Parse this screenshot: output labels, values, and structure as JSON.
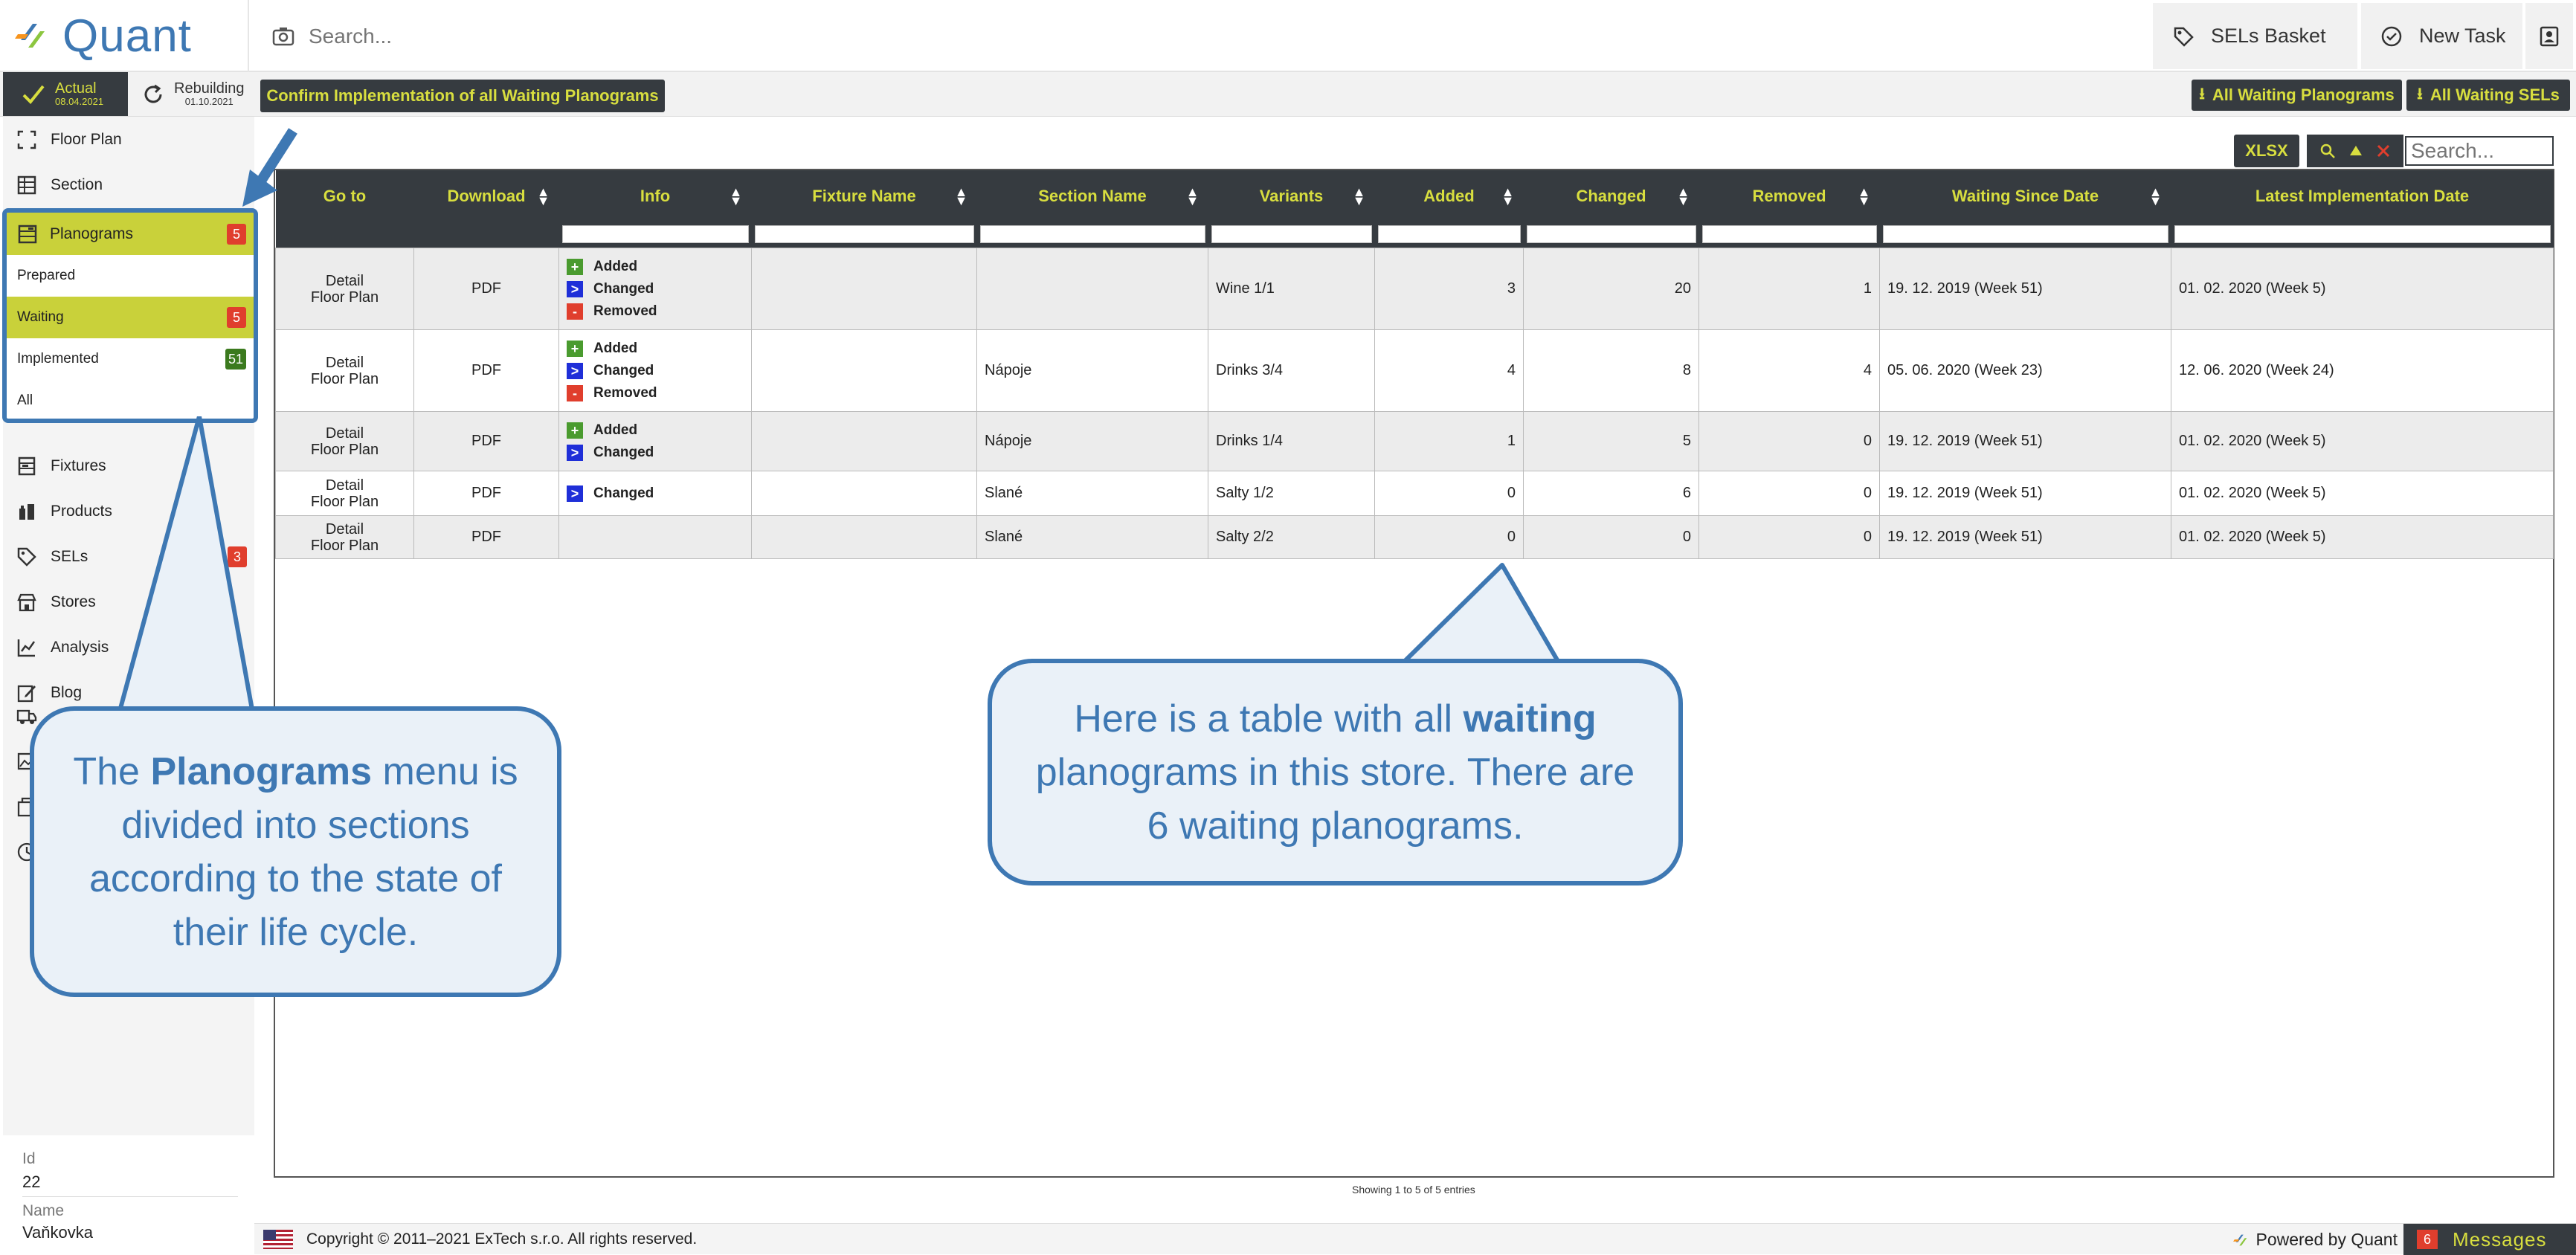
{
  "app": {
    "name": "Quant"
  },
  "topbar": {
    "search_placeholder": "Search...",
    "sels_basket": "SELs Basket",
    "new_task": "New Task"
  },
  "toolbar": {
    "actual_label": "Actual",
    "actual_date": "08.04.2021",
    "rebuilding_label": "Rebuilding",
    "rebuilding_date": "01.10.2021",
    "confirm_button": "Confirm Implementation of all Waiting Planograms",
    "all_waiting_planograms": "All Waiting Planograms",
    "all_waiting_sels": "All Waiting SELs"
  },
  "sidebar": {
    "items": [
      {
        "label": "Floor Plan",
        "icon": "floor-plan-icon"
      },
      {
        "label": "Section",
        "icon": "section-icon"
      },
      {
        "label": "Planograms",
        "icon": "planograms-icon",
        "badge": "5"
      },
      {
        "label": "Fixtures",
        "icon": "fixtures-icon"
      },
      {
        "label": "Products",
        "icon": "products-icon"
      },
      {
        "label": "SELs",
        "icon": "sels-icon",
        "badge": "3"
      },
      {
        "label": "Stores",
        "icon": "stores-icon"
      },
      {
        "label": "Analysis",
        "icon": "analysis-icon"
      },
      {
        "label": "Blog",
        "icon": "blog-icon"
      }
    ],
    "planogram_states": [
      {
        "label": "Prepared"
      },
      {
        "label": "Waiting",
        "badge": "5"
      },
      {
        "label": "Implemented",
        "badge": "51"
      },
      {
        "label": "All"
      }
    ],
    "store_info": {
      "id_label": "Id",
      "id_value": "22",
      "name_label": "Name",
      "name_value": "Vaňkovka"
    }
  },
  "table_tools": {
    "xlsx": "XLSX",
    "search_placeholder": "Search..."
  },
  "table": {
    "columns": [
      "Go to",
      "Download",
      "Info",
      "Fixture Name",
      "Section Name",
      "Variants",
      "Added",
      "Changed",
      "Removed",
      "Waiting Since Date",
      "Latest Implementation Date"
    ],
    "info_labels": {
      "added": "Added",
      "changed": "Changed",
      "removed": "Removed"
    },
    "rows": [
      {
        "goto1": "Detail",
        "goto2": "Floor Plan",
        "download": "PDF",
        "info": [
          "added",
          "changed",
          "removed"
        ],
        "fixture": "",
        "section": "",
        "variants": "Wine 1/1",
        "added": "3",
        "changed": "20",
        "removed": "1",
        "waiting_since": "19. 12. 2019 (Week 51)",
        "latest_impl": "01. 02. 2020 (Week 5)"
      },
      {
        "goto1": "Detail",
        "goto2": "Floor Plan",
        "download": "PDF",
        "info": [
          "added",
          "changed",
          "removed"
        ],
        "fixture": "",
        "section": "Nápoje",
        "variants": "Drinks 3/4",
        "added": "4",
        "changed": "8",
        "removed": "4",
        "waiting_since": "05. 06. 2020 (Week 23)",
        "latest_impl": "12. 06. 2020 (Week 24)"
      },
      {
        "goto1": "Detail",
        "goto2": "Floor Plan",
        "download": "PDF",
        "info": [
          "added",
          "changed"
        ],
        "fixture": "",
        "section": "Nápoje",
        "variants": "Drinks 1/4",
        "added": "1",
        "changed": "5",
        "removed": "0",
        "waiting_since": "19. 12. 2019 (Week 51)",
        "latest_impl": "01. 02. 2020 (Week 5)"
      },
      {
        "goto1": "Detail",
        "goto2": "Floor Plan",
        "download": "PDF",
        "info": [
          "changed"
        ],
        "fixture": "",
        "section": "Slané",
        "variants": "Salty 1/2",
        "added": "0",
        "changed": "6",
        "removed": "0",
        "waiting_since": "19. 12. 2019 (Week 51)",
        "latest_impl": "01. 02. 2020 (Week 5)"
      },
      {
        "goto1": "Detail",
        "goto2": "Floor Plan",
        "download": "PDF",
        "info": [],
        "fixture": "",
        "section": "Slané",
        "variants": "Salty 2/2",
        "added": "0",
        "changed": "0",
        "removed": "0",
        "waiting_since": "19. 12. 2019 (Week 51)",
        "latest_impl": "01. 02. 2020 (Week 5)"
      }
    ],
    "showing": "Showing 1 to 5 of 5 entries"
  },
  "footer": {
    "copyright": "Copyright © 2011–2021 ExTech s.r.o. All rights reserved.",
    "powered_by": "Powered by Quant",
    "messages_label": "Messages",
    "messages_count": "6"
  },
  "callouts": {
    "left": {
      "pre": "The ",
      "bold": "Planograms",
      "post": " menu is divided into sections according to the state of their life cycle."
    },
    "right": {
      "pre": "Here is a table with all ",
      "bold": "waiting",
      "post": " planograms in this store. There are 6 waiting planograms."
    }
  },
  "colors": {
    "accent": "#d8de3f",
    "dark": "#363b40",
    "callout_blue": "#3e78b3",
    "badge_red": "#e03e2d",
    "badge_green": "#3b7a1e",
    "highlight": "#c9d13a"
  }
}
